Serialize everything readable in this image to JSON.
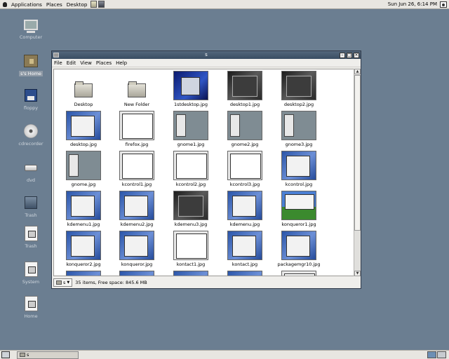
{
  "top_panel": {
    "menus": [
      "Applications",
      "Places",
      "Desktop"
    ],
    "clock": "Sun Jun 26,  6:14 PM"
  },
  "desktop_icons": [
    {
      "label": "Computer",
      "icon": "computer-icon"
    },
    {
      "label": "s's Home",
      "icon": "home-folder-icon",
      "selected": true
    },
    {
      "label": "floppy",
      "icon": "floppy-icon"
    },
    {
      "label": "cdrecorder",
      "icon": "cd-icon"
    },
    {
      "label": "dvd",
      "icon": "dvd-icon"
    },
    {
      "label": "Trash",
      "icon": "trash-icon"
    },
    {
      "label": "Trash",
      "icon": "file-icon"
    },
    {
      "label": "System",
      "icon": "file-icon"
    },
    {
      "label": "Home",
      "icon": "file-icon"
    }
  ],
  "window": {
    "title": "s",
    "menubar": [
      "File",
      "Edit",
      "View",
      "Places",
      "Help"
    ],
    "files": [
      {
        "name": "Desktop",
        "kind": "folder"
      },
      {
        "name": "New Folder",
        "kind": "folder"
      },
      {
        "name": "1stdesktop.jpg",
        "kind": "desk"
      },
      {
        "name": "desktop1.jpg",
        "kind": "dark"
      },
      {
        "name": "desktop2.jpg",
        "kind": "dark"
      },
      {
        "name": "desktop.jpg",
        "kind": "blue"
      },
      {
        "name": "firefox.jpg",
        "kind": "window"
      },
      {
        "name": "gnome1.jpg",
        "kind": "gray"
      },
      {
        "name": "gnome2.jpg",
        "kind": "gray"
      },
      {
        "name": "gnome3.jpg",
        "kind": "gray"
      },
      {
        "name": "gnome.jpg",
        "kind": "gray"
      },
      {
        "name": "kcontrol1.jpg",
        "kind": "window"
      },
      {
        "name": "kcontrol2.jpg",
        "kind": "window"
      },
      {
        "name": "kcontrol3.jpg",
        "kind": "window"
      },
      {
        "name": "kcontrol.jpg",
        "kind": "blue"
      },
      {
        "name": "kdemenu1.jpg",
        "kind": "blue"
      },
      {
        "name": "kdemenu2.jpg",
        "kind": "blue"
      },
      {
        "name": "kdemenu3.jpg",
        "kind": "dark"
      },
      {
        "name": "kdemenu.jpg",
        "kind": "blue"
      },
      {
        "name": "konqueror1.jpg",
        "kind": "xp"
      },
      {
        "name": "konqueror2.jpg",
        "kind": "blue"
      },
      {
        "name": "konqueror.jpg",
        "kind": "blue"
      },
      {
        "name": "kontact1.jpg",
        "kind": "window"
      },
      {
        "name": "kontact.jpg",
        "kind": "blue"
      },
      {
        "name": "packagemgr10.jpg",
        "kind": "blue"
      },
      {
        "name": "",
        "kind": "blue"
      },
      {
        "name": "",
        "kind": "blue"
      },
      {
        "name": "",
        "kind": "blue"
      },
      {
        "name": "",
        "kind": "blue"
      },
      {
        "name": "",
        "kind": "window"
      }
    ],
    "status_path": "s",
    "status_text": "35 items, Free space: 845.6 MB"
  },
  "bottom_panel": {
    "task_label": "s",
    "workspace_count": 2
  }
}
